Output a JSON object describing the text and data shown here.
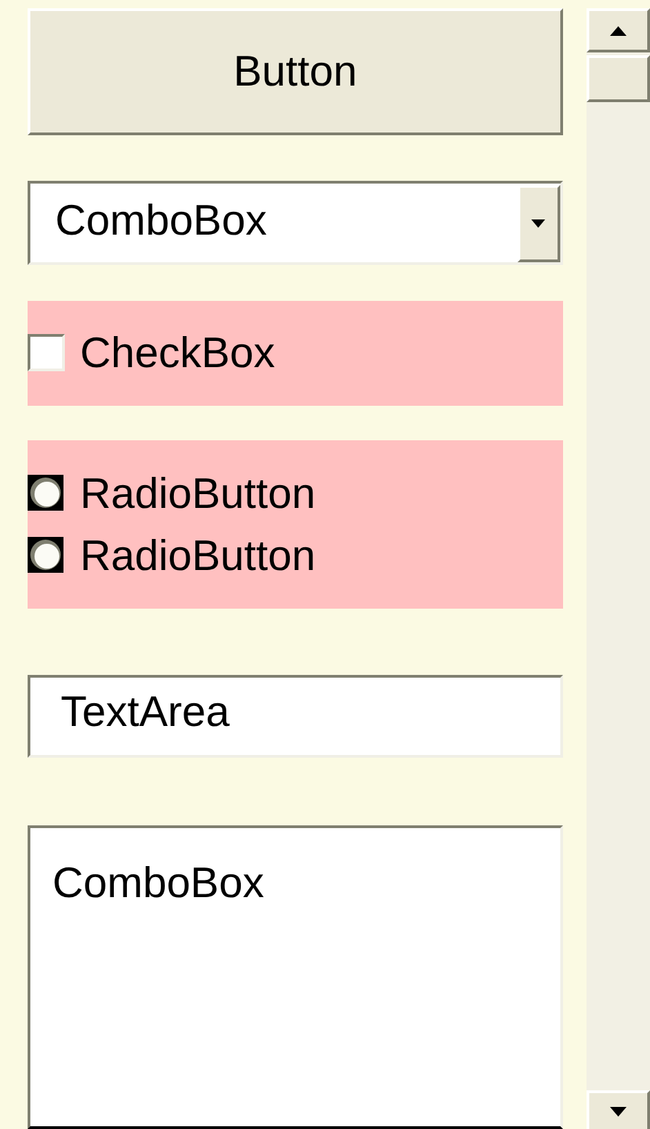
{
  "button": {
    "label": "Button"
  },
  "combo_box": {
    "value": "ComboBox"
  },
  "checkbox": {
    "label": "CheckBox",
    "checked": false
  },
  "radio_buttons": [
    {
      "label": "RadioButton",
      "selected": false
    },
    {
      "label": "RadioButton",
      "selected": false
    }
  ],
  "text_area": {
    "value": "TextArea"
  },
  "list_box": {
    "items": [
      "ComboBox"
    ]
  }
}
